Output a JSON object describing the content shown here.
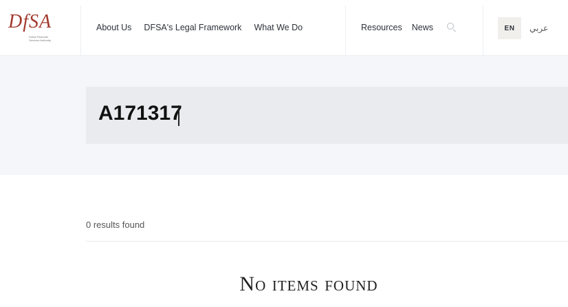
{
  "logo": {
    "text": "DfSA",
    "subtitle": "Dubai Financial Services Authority"
  },
  "nav_primary": [
    {
      "label": "About Us"
    },
    {
      "label": "DFSA's Legal Framework"
    },
    {
      "label": "What We Do"
    }
  ],
  "nav_secondary": [
    {
      "label": "Resources"
    },
    {
      "label": "News"
    }
  ],
  "language": {
    "active": "EN",
    "alternate": "عربي"
  },
  "search": {
    "value": "A171317"
  },
  "results": {
    "count_text": "0 results found",
    "empty_message": "No items found"
  },
  "colors": {
    "brand": "#a23a2e",
    "band_bg": "#f4f6f9",
    "search_bg": "#e9ebef"
  },
  "icons": [
    "search-icon"
  ]
}
